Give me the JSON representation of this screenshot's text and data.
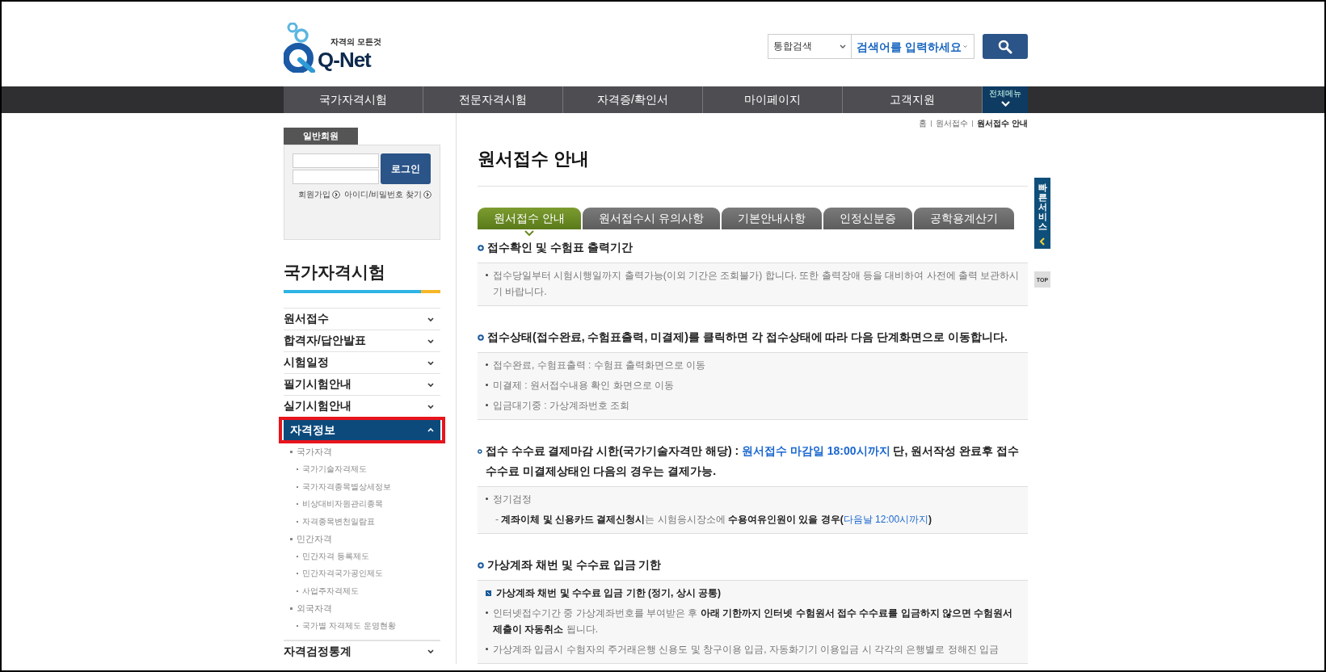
{
  "header": {
    "logo": {
      "tagline": "자격의 모든것",
      "name": "Q-Net"
    },
    "search": {
      "scope": "통합검색",
      "placeholder": "검색어를 입력하세요"
    }
  },
  "nav": {
    "items": [
      "국가자격시험",
      "전문자격시험",
      "자격증/확인서",
      "마이페이지",
      "고객지원"
    ],
    "all_menu": "전체메뉴"
  },
  "login": {
    "tab": "일반회원",
    "button": "로그인",
    "links": [
      "회원가입",
      "아이디/비밀번호 찾기"
    ]
  },
  "sidebar": {
    "title": "국가자격시험",
    "items": [
      {
        "label": "원서접수",
        "expanded": false,
        "selected": false,
        "highlighted": false
      },
      {
        "label": "합격자/답안발표",
        "expanded": false,
        "selected": false,
        "highlighted": false
      },
      {
        "label": "시험일정",
        "expanded": false,
        "selected": false,
        "highlighted": false
      },
      {
        "label": "필기시험안내",
        "expanded": false,
        "selected": false,
        "highlighted": false
      },
      {
        "label": "실기시험안내",
        "expanded": false,
        "selected": false,
        "highlighted": false
      },
      {
        "label": "자격정보",
        "expanded": true,
        "selected": true,
        "highlighted": true,
        "children": [
          {
            "label": "국가자격",
            "children": [
              {
                "label": "국가기술자격제도"
              },
              {
                "label": "국가자격종목별상세정보"
              },
              {
                "label": "비상대비자원관리종목"
              },
              {
                "label": "자격종목변천일람표"
              }
            ]
          },
          {
            "label": "민간자격",
            "children": [
              {
                "label": "민간자격 등록제도"
              },
              {
                "label": "민간자격국가공인제도"
              },
              {
                "label": "사업주자격제도"
              }
            ]
          },
          {
            "label": "외국자격",
            "children": [
              {
                "label": "국가별 자격제도 운영현황"
              }
            ]
          }
        ]
      },
      {
        "label": "자격검정통계",
        "expanded": false,
        "selected": false,
        "highlighted": false
      }
    ]
  },
  "breadcrumb": [
    "홈",
    "원서접수",
    "원서접수 안내"
  ],
  "page_title": "원서접수 안내",
  "tabs": [
    {
      "label": "원서접수 안내",
      "selected": true
    },
    {
      "label": "원서접수시 유의사항",
      "selected": false
    },
    {
      "label": "기본안내사항",
      "selected": false
    },
    {
      "label": "인정신분증",
      "selected": false
    },
    {
      "label": "공학용계산기",
      "selected": false
    }
  ],
  "sections": [
    {
      "title": [
        {
          "text": "접수확인 및 수험표 출력기간"
        }
      ],
      "items": [
        {
          "kind": "bullet",
          "segments": [
            {
              "text": "접수당일부터 시험시행일까지 출력가능(이외 기간은 조회불가) 합니다. 또한 출력장애 등을 대비하여 사전에 출력 보관하시기 바랍니다."
            }
          ]
        }
      ]
    },
    {
      "title": [
        {
          "text": "접수상태(접수완료, 수험표출력, 미결제)를 클릭하면 각 접수상태에 따라 다음 단계화면으로 이동합니다."
        }
      ],
      "items": [
        {
          "kind": "bullet",
          "segments": [
            {
              "text": "접수완료, 수험표출력 : 수험표 출력화면으로 이동"
            }
          ]
        },
        {
          "kind": "bullet",
          "segments": [
            {
              "text": "미결제 : 원서접수내용 확인 화면으로 이동"
            }
          ]
        },
        {
          "kind": "bullet",
          "segments": [
            {
              "text": "입금대기중 : 가상계좌번호 조회"
            }
          ]
        }
      ]
    },
    {
      "title": [
        {
          "text": "접수 수수료 결제마감 시한(국가기술자격만 해당) : "
        },
        {
          "text": "원서접수 마감일 18:00시까지",
          "kind": "blue"
        },
        {
          "text": " 단, 원서작성 완료후 접수수수료 미결제상태인 다음의 경우는 결제가능."
        }
      ],
      "items": [
        {
          "kind": "bullet",
          "segments": [
            {
              "text": "정기검정"
            }
          ]
        },
        {
          "kind": "dash",
          "segments": [
            {
              "text": "- "
            },
            {
              "text": "계좌이체 및 신용카드 결제신청시",
              "kind": "bold"
            },
            {
              "text": "는 시험응시장소에 "
            },
            {
              "text": "수용여유인원이 있을 경우(",
              "kind": "bold"
            },
            {
              "text": "다음날 12:00시까지",
              "kind": "blue"
            },
            {
              "text": ")",
              "kind": "bold"
            }
          ]
        }
      ]
    },
    {
      "title": [
        {
          "text": "가상계좌 채번 및 수수료 입금 기한"
        }
      ],
      "items": [
        {
          "kind": "subheading",
          "segments": [
            {
              "text": "가상계좌 채번 및 수수료 입금 기한 (정기, 상시 공통)"
            }
          ]
        },
        {
          "kind": "bullet",
          "segments": [
            {
              "text": "인터넷접수기간 중 가상계좌번호를 부여받은 후 "
            },
            {
              "text": "아래 기한까지 인터넷 수험원서 접수 수수료를 입금하지 않으면 수험원서 제출이 자동취소",
              "kind": "bold"
            },
            {
              "text": " 됩니다."
            }
          ]
        },
        {
          "kind": "bullet",
          "segments": [
            {
              "text": "가상계좌 입금시 수험자의 주거래은행 신용도 및 창구이용 입금, 자동화기기 이용입금 시 각각의 은행별로 정해진 입금"
            }
          ]
        }
      ]
    }
  ],
  "quick_service": {
    "label": "빠른서비스",
    "top": "TOP"
  }
}
